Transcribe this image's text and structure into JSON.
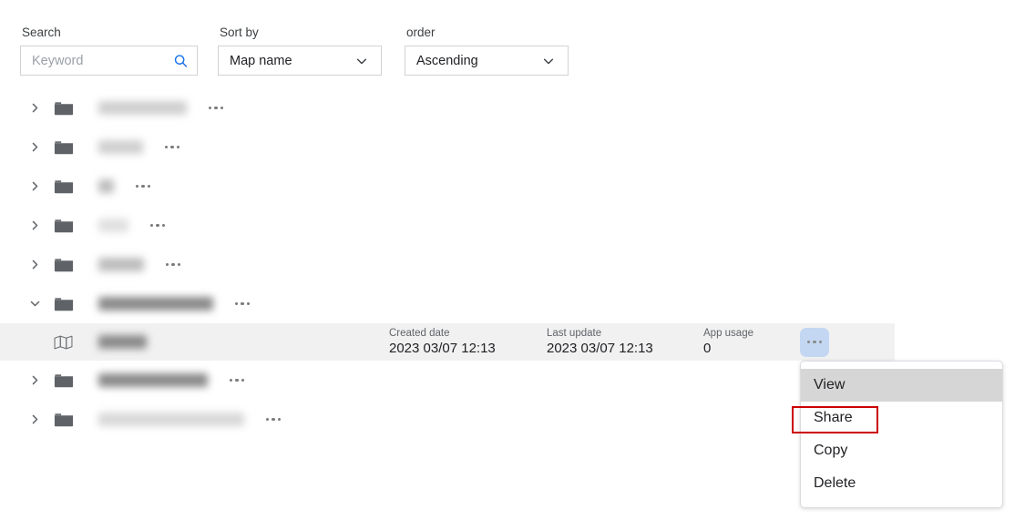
{
  "toolbar": {
    "search": {
      "label": "Search",
      "placeholder": "Keyword",
      "value": "",
      "icon": "search-icon"
    },
    "sort_by": {
      "label": "Sort by",
      "value": "Map name",
      "icon": "chevron-down-icon"
    },
    "order": {
      "label": "order",
      "value": "Ascending",
      "icon": "chevron-down-icon"
    }
  },
  "tree": {
    "rows": [
      {
        "type": "folder",
        "expanded": false,
        "twisty": "chevron-right-icon",
        "icon": "folder-icon",
        "name": "",
        "name_redacted": true,
        "name_width": 97,
        "name_shade": "d1",
        "menu_icon": "overflow-dots-icon"
      },
      {
        "type": "folder",
        "expanded": false,
        "twisty": "chevron-right-icon",
        "icon": "folder-icon",
        "name": "",
        "name_redacted": true,
        "name_width": 49,
        "name_shade": "d1",
        "menu_icon": "overflow-dots-icon"
      },
      {
        "type": "folder",
        "expanded": false,
        "twisty": "chevron-right-icon",
        "icon": "folder-icon",
        "name": "",
        "name_redacted": true,
        "name_width": 17,
        "name_shade": "d2",
        "menu_icon": "overflow-dots-icon"
      },
      {
        "type": "folder",
        "expanded": false,
        "twisty": "chevron-right-icon",
        "icon": "folder-icon",
        "name": "",
        "name_redacted": true,
        "name_width": 33,
        "name_shade": "d5",
        "menu_icon": "overflow-dots-icon"
      },
      {
        "type": "folder",
        "expanded": false,
        "twisty": "chevron-right-icon",
        "icon": "folder-icon",
        "name": "",
        "name_redacted": true,
        "name_width": 50,
        "name_shade": "d2",
        "menu_icon": "overflow-dots-icon"
      },
      {
        "type": "folder",
        "expanded": true,
        "twisty": "chevron-down-icon",
        "icon": "folder-icon",
        "name": "",
        "name_redacted": true,
        "name_width": 126,
        "name_shade": "d4",
        "menu_icon": "overflow-dots-icon"
      },
      {
        "type": "map",
        "icon": "map-icon",
        "name": "",
        "name_redacted": true,
        "name_width": 53,
        "name_shade": "d4",
        "menu_icon": "overflow-dots-icon",
        "selected": true,
        "meta": {
          "created_label": "Created date",
          "created_value": "2023 03/07 12:13",
          "updated_label": "Last update",
          "updated_value": "2023 03/07 12:13",
          "usage_label": "App usage",
          "usage_value": "0"
        }
      },
      {
        "type": "folder",
        "expanded": false,
        "twisty": "chevron-right-icon",
        "icon": "folder-icon",
        "name": "",
        "name_redacted": true,
        "name_width": 120,
        "name_shade": "d4",
        "menu_icon": "overflow-dots-icon"
      },
      {
        "type": "folder",
        "expanded": false,
        "twisty": "chevron-right-icon",
        "icon": "folder-icon",
        "name": "",
        "name_redacted": true,
        "name_width": 160,
        "name_shade": "d6",
        "menu_icon": "overflow-dots-icon"
      }
    ]
  },
  "context_menu": {
    "items": [
      {
        "label": "View",
        "state": "hover"
      },
      {
        "label": "Share",
        "state": "highlighted"
      },
      {
        "label": "Copy",
        "state": "normal"
      },
      {
        "label": "Delete",
        "state": "normal"
      }
    ]
  },
  "colors": {
    "accent_blue": "#1a73e8",
    "highlight_red": "#cc0000",
    "row_selected_bg": "#f1f1f1",
    "menu_hover_bg": "#d6d6d6",
    "dots_button_bg": "#c3d7f2",
    "folder_icon": "#5f6368"
  }
}
